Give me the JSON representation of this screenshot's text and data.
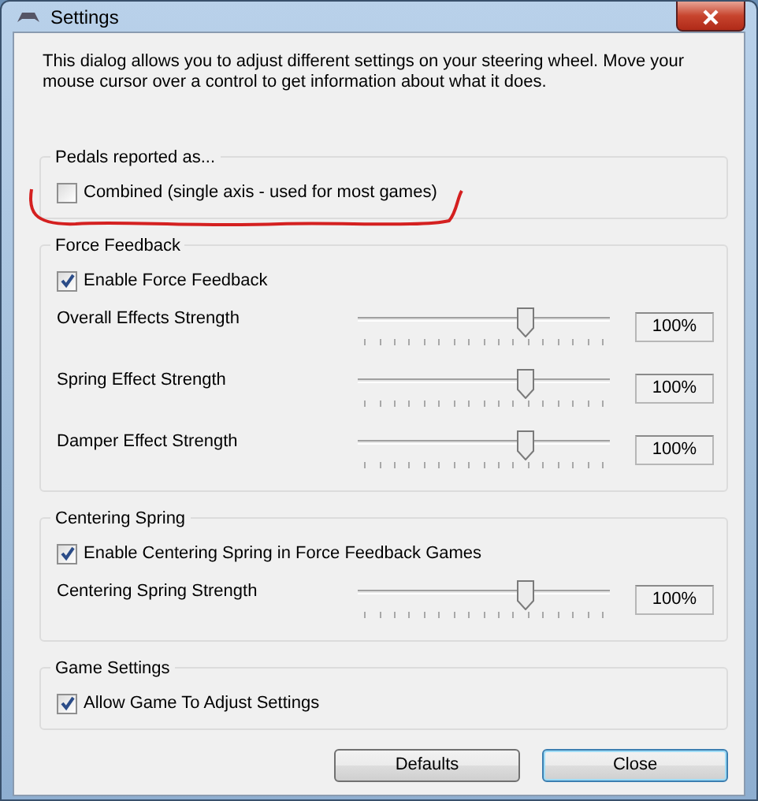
{
  "window": {
    "title": "Settings"
  },
  "intro": "This dialog allows you to adjust different settings on your steering wheel.  Move your mouse cursor over a control to get information about what it does.",
  "groups": [
    {
      "title": "Pedals reported as...",
      "items": [
        {
          "kind": "checkbox",
          "label": "Combined (single axis - used for most games)",
          "checked": false
        }
      ]
    },
    {
      "title": "Force Feedback",
      "items": [
        {
          "kind": "checkbox",
          "label": "Enable Force Feedback",
          "checked": true
        },
        {
          "kind": "slider",
          "label": "Overall Effects Strength",
          "level": 0.66,
          "reading": "100%"
        },
        {
          "kind": "slider",
          "label": "Spring Effect Strength",
          "level": 0.66,
          "reading": "100%"
        },
        {
          "kind": "slider",
          "label": "Damper Effect Strength",
          "level": 0.66,
          "reading": "100%"
        }
      ]
    },
    {
      "title": "Centering Spring",
      "items": [
        {
          "kind": "checkbox",
          "label": "Enable Centering Spring in Force Feedback Games",
          "checked": true
        },
        {
          "kind": "slider",
          "label": "Centering Spring Strength",
          "level": 0.66,
          "reading": "100%"
        }
      ]
    },
    {
      "title": "Game Settings",
      "items": [
        {
          "kind": "checkbox",
          "label": "Allow Game To Adjust Settings",
          "checked": true
        }
      ]
    }
  ],
  "buttons": [
    {
      "label": "Defaults",
      "default": false
    },
    {
      "label": "Close",
      "default": true
    }
  ]
}
